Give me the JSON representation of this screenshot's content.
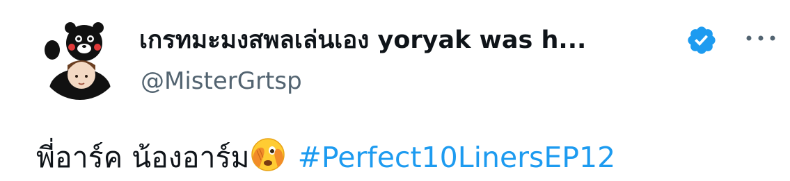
{
  "author": {
    "display_name": "เกรทมะมงสพลเล่นเอง yoryak was h...",
    "handle": "@MisterGrtsp",
    "verified_icon": "verified-badge-icon",
    "avatar_icon": "kumamon-avatar"
  },
  "menu": {
    "more_icon": "more-options-icon"
  },
  "tweet": {
    "text": "พี่อาร์ค น้องอาร์ม",
    "emoji": "face-with-peeking-eye",
    "hashtag": "#Perfect10LinersEP12"
  },
  "colors": {
    "text": "#0f1419",
    "secondary": "#536471",
    "link": "#1d9bf0",
    "verified": "#1d9bf0"
  }
}
